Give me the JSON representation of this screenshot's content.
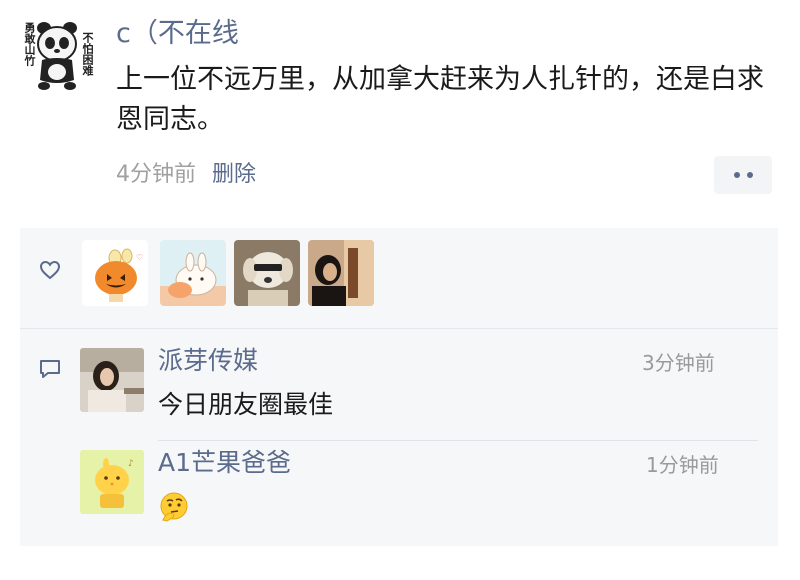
{
  "post": {
    "avatar_left_text": "勇敢山竹",
    "avatar_right_text": "不怕困难",
    "username": "c（不在线",
    "text": "上一位不远万里，从加拿大赶来为人扎针的，还是白求恩同志。",
    "time": "4分钟前",
    "delete_label": "删除"
  },
  "likes": {
    "avatars": [
      "pumpkin-avatar",
      "bunny-avatar",
      "dog-avatar",
      "person-avatar"
    ]
  },
  "comments": [
    {
      "name": "派芽传媒",
      "time": "3分钟前",
      "text": "今日朋友圈最佳"
    },
    {
      "name": "A1芒果爸爸",
      "time": "1分钟前",
      "text": ""
    }
  ],
  "colors": {
    "name_link": "#5b6b8c",
    "meta_gray": "#a0a0a0",
    "panel_bg": "#f6f7f9"
  }
}
